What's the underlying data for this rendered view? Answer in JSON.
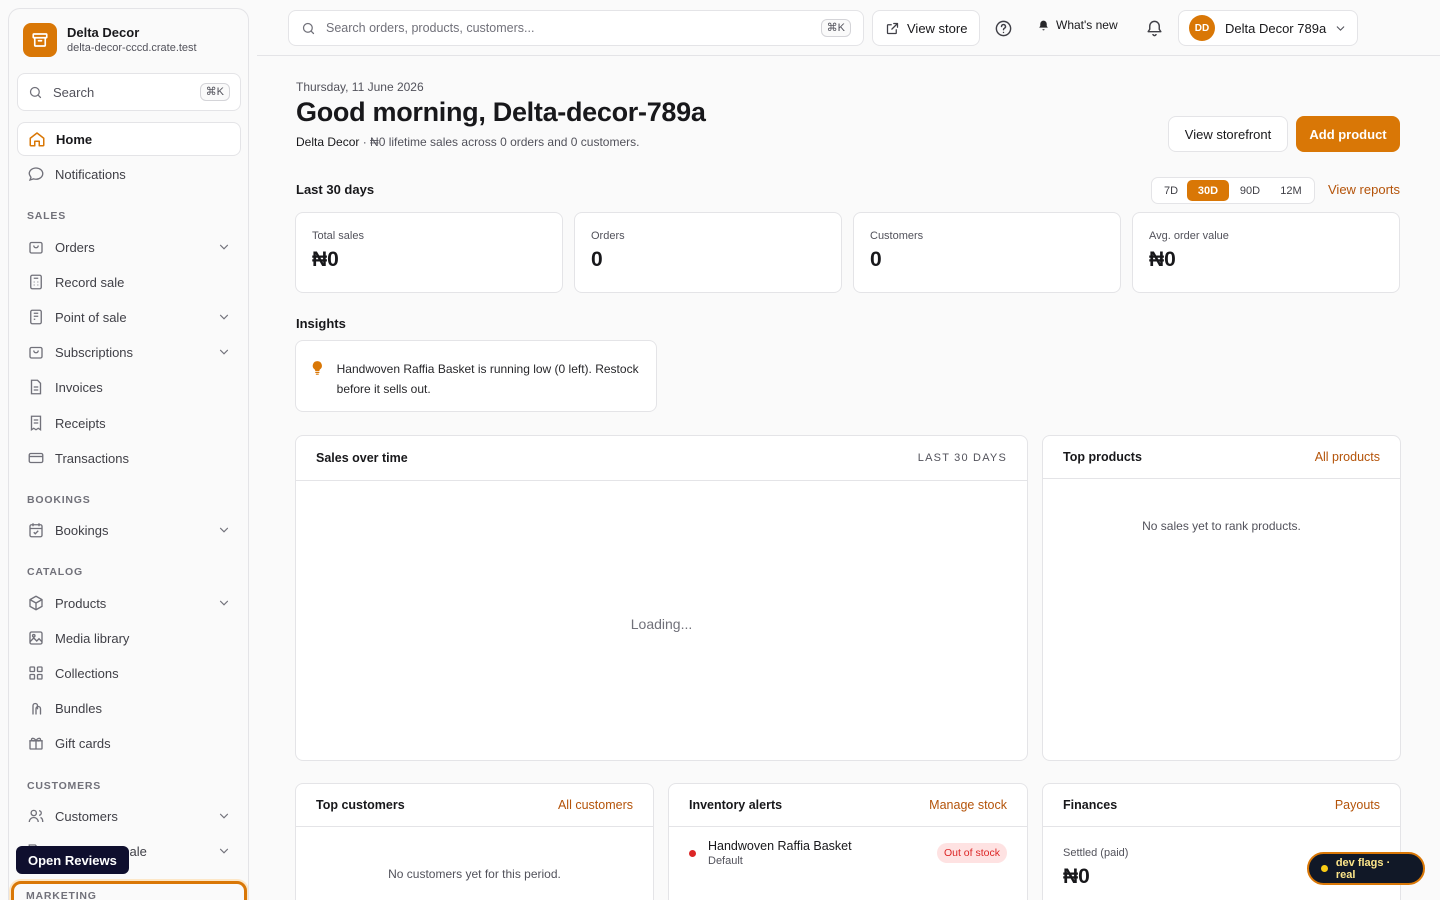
{
  "brand": {
    "name": "Delta Decor",
    "domain": "delta-decor-cccd.crate.test"
  },
  "sidebar": {
    "search_label": "Search",
    "search_kbd": "⌘K",
    "items": [
      {
        "label": "Home"
      },
      {
        "label": "Notifications"
      },
      {
        "label": "Orders"
      },
      {
        "label": "Record sale"
      },
      {
        "label": "Point of sale"
      },
      {
        "label": "Subscriptions"
      },
      {
        "label": "Invoices"
      },
      {
        "label": "Receipts"
      },
      {
        "label": "Transactions"
      },
      {
        "label": "Bookings"
      },
      {
        "label": "Products"
      },
      {
        "label": "Media library"
      },
      {
        "label": "Collections"
      },
      {
        "label": "Bundles"
      },
      {
        "label": "Gift cards"
      },
      {
        "label": "Customers"
      },
      {
        "label": "sale"
      }
    ],
    "sections": {
      "sales": "SALES",
      "bookings": "BOOKINGS",
      "catalog": "CATALOG",
      "customers": "CUSTOMERS",
      "marketing": "MARKETING"
    },
    "open_reviews": "Open Reviews"
  },
  "topbar": {
    "search_placeholder": "Search orders, products, customers...",
    "search_kbd": "⌘K",
    "view_store": "View store",
    "whats_new": "What's new",
    "account_initials": "DD",
    "account_name": "Delta Decor 789a"
  },
  "header": {
    "date": "Thursday, 11 June 2026",
    "greeting": "Good morning, Delta-decor-789a",
    "store_name": "Delta Decor",
    "summary": " · ₦0 lifetime sales across 0 orders and 0 customers.",
    "view_storefront": "View storefront",
    "add_product": "Add product"
  },
  "period": {
    "title": "Last 30 days",
    "ranges": [
      "7D",
      "30D",
      "90D",
      "12M"
    ],
    "selected": "30D",
    "view_reports": "View reports"
  },
  "stats": [
    {
      "title": "Total sales",
      "value": "₦0"
    },
    {
      "title": "Orders",
      "value": "0"
    },
    {
      "title": "Customers",
      "value": "0"
    },
    {
      "title": "Avg. order value",
      "value": "₦0"
    }
  ],
  "insights": {
    "title": "Insights",
    "message": "Handwoven Raffia Basket is running low (0 left). Restock before it sells out."
  },
  "sales_panel": {
    "title": "Sales over time",
    "meta": "LAST 30 DAYS",
    "loading": "Loading..."
  },
  "top_products": {
    "title": "Top products",
    "link": "All products",
    "empty": "No sales yet to rank products."
  },
  "top_customers": {
    "title": "Top customers",
    "link": "All customers",
    "empty": "No customers yet for this period."
  },
  "inventory": {
    "title": "Inventory alerts",
    "link": "Manage stock",
    "items": [
      {
        "name": "Handwoven Raffia Basket",
        "variant": "Default",
        "status": "Out of stock"
      }
    ]
  },
  "finances": {
    "title": "Finances",
    "link": "Payouts",
    "settled_label": "Settled (paid)",
    "settled_value": "₦0"
  },
  "dev_flags": "dev flags · real",
  "colors": {
    "accent": "#d97706",
    "danger": "#dc2626",
    "link": "#b45309"
  }
}
